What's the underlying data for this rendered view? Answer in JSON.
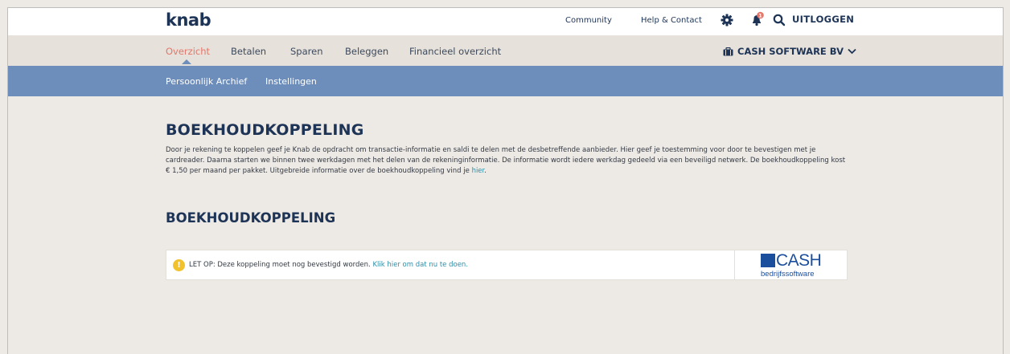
{
  "header": {
    "logo": "knab",
    "links": [
      "Community",
      "Help & Contact"
    ],
    "notification_count": "1",
    "logout_label": "UITLOGGEN"
  },
  "main_nav": {
    "items": [
      "Overzicht",
      "Betalen",
      "Sparen",
      "Beleggen",
      "Financieel overzicht"
    ],
    "active_item": "Overzicht",
    "account_name": "CASH SOFTWARE BV"
  },
  "sub_nav": {
    "items": [
      "Persoonlijk Archief",
      "Instellingen"
    ]
  },
  "content": {
    "title": "BOEKHOUDKOPPELING",
    "intro_text": "Door je rekening te koppelen geef je Knab de opdracht om transactie-informatie en saldi te delen met de desbetreffende aanbieder. Hier geef je toestemming voor door te bevestigen met je cardreader. Daarna starten we binnen twee werkdagen met het delen van de rekeninginformatie. De informatie wordt iedere werkdag gedeeld via een beveiligd netwerk. De boekhoudkoppeling kost € 1,50 per maand per pakket. Uitgebreide informatie over de boekhoudkoppeling vind je ",
    "intro_link": "hier",
    "intro_end": ".",
    "section_title": "BOEKHOUDKOPPELING",
    "connection": {
      "warning_text": "LET OP: Deze koppeling moet nog bevestigd worden.",
      "warning_link": "Klik hier om dat nu te doen.",
      "provider_logo_word": "CASH",
      "provider_logo_sub": "bedrijfssoftware"
    }
  },
  "colors": {
    "brand_navy": "#1d3456",
    "subnav_blue": "#6d8dbb",
    "active_nav": "#e4766a",
    "link_teal": "#2d8ea8",
    "warning_yellow": "#f2c12e",
    "cash_blue": "#1b4e9c",
    "background": "#ede9e4"
  },
  "icons": [
    "settings-gear-icon",
    "notification-bell-icon",
    "search-icon",
    "briefcase-icon",
    "chevron-down-icon",
    "warning-icon"
  ]
}
